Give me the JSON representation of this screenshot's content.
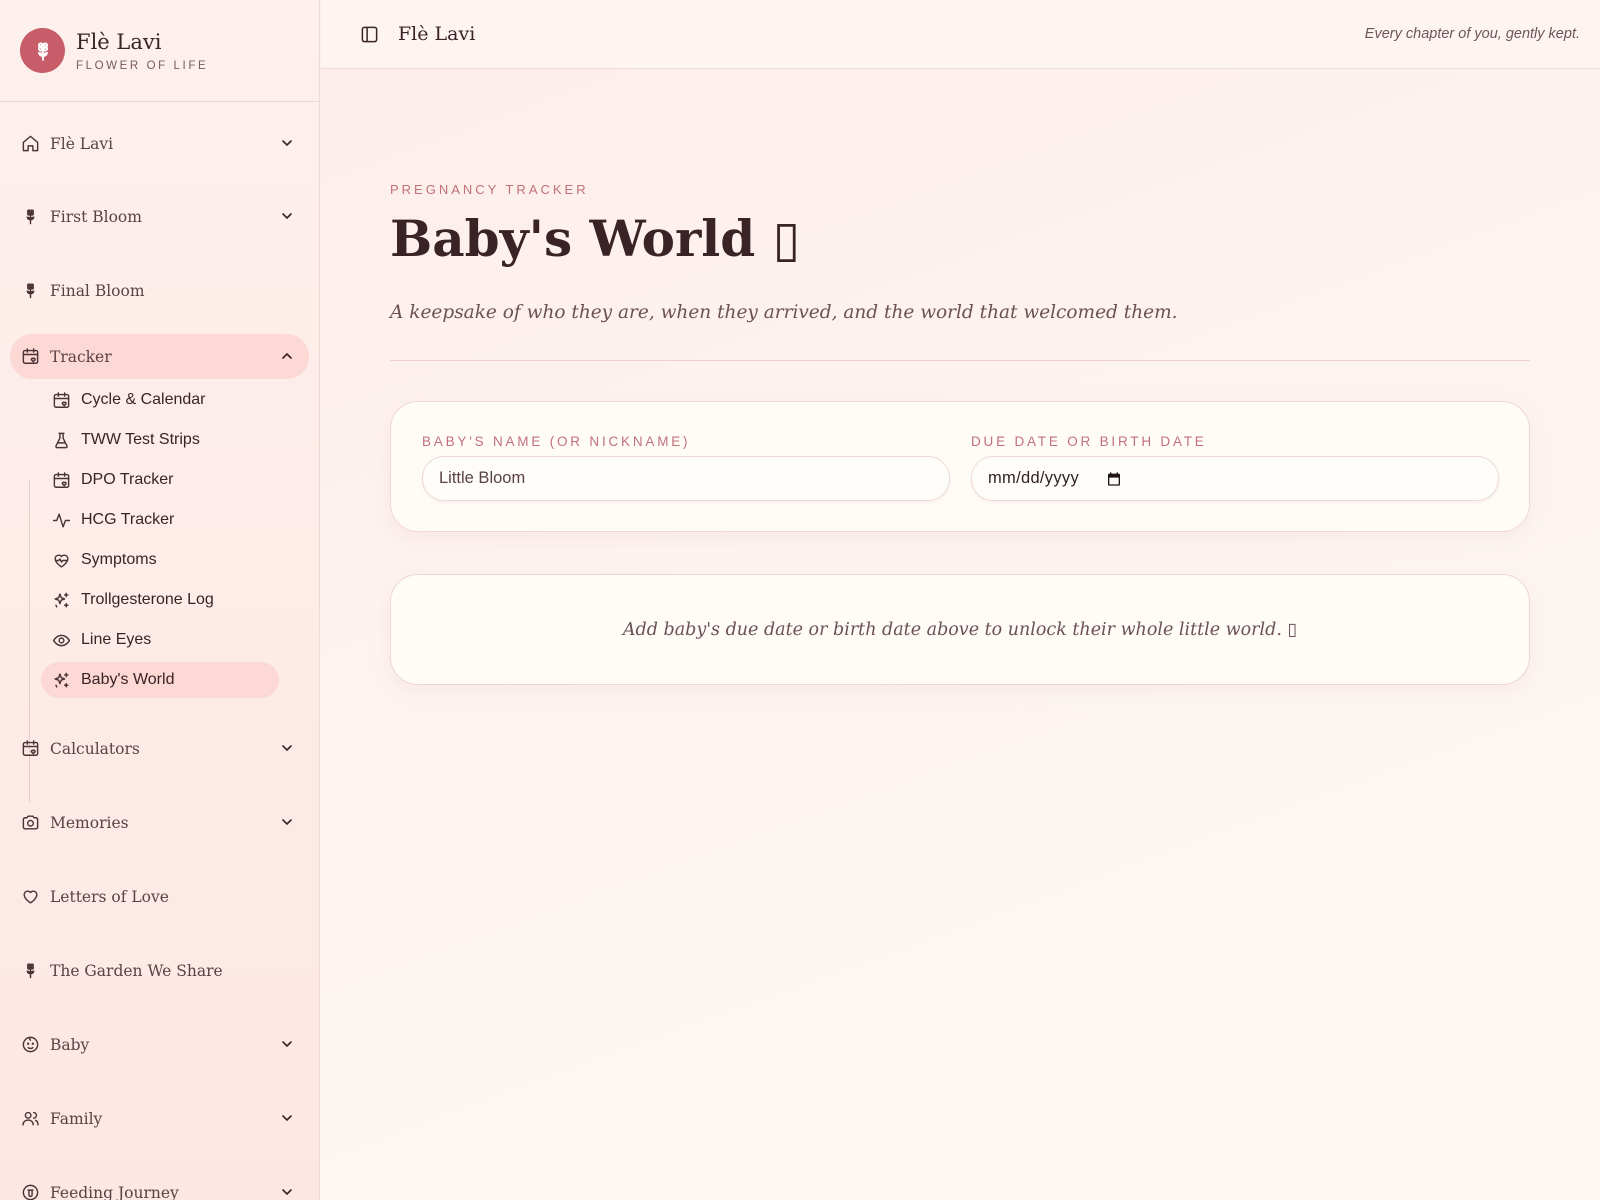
{
  "brand": {
    "title": "Flè Lavi",
    "subtitle": "FLOWER OF LIFE"
  },
  "topbar": {
    "title": "Flè Lavi",
    "tagline": "Every chapter of you, gently kept."
  },
  "sidebar": {
    "items": [
      {
        "label": "Flè Lavi",
        "icon": "home-icon",
        "chevron": "down"
      },
      {
        "label": "First Bloom",
        "icon": "flower-icon",
        "chevron": "down"
      },
      {
        "label": "Final Bloom",
        "icon": "flower-icon"
      },
      {
        "label": "Tracker",
        "icon": "calendar-heart-icon",
        "chevron": "up",
        "active": true
      },
      {
        "label": "Calculators",
        "icon": "calendar-heart-icon",
        "chevron": "down"
      },
      {
        "label": "Memories",
        "icon": "camera-icon",
        "chevron": "down"
      },
      {
        "label": "Letters of Love",
        "icon": "heart-icon"
      },
      {
        "label": "The Garden We Share",
        "icon": "flower-icon"
      },
      {
        "label": "Baby",
        "icon": "baby-icon",
        "chevron": "down"
      },
      {
        "label": "Family",
        "icon": "users-icon",
        "chevron": "down"
      },
      {
        "label": "Feeding Journey",
        "icon": "milk-icon",
        "chevron": "down"
      }
    ],
    "tracker_sub": [
      {
        "label": "Cycle & Calendar",
        "icon": "calendar-heart-icon"
      },
      {
        "label": "TWW Test Strips",
        "icon": "flask-icon"
      },
      {
        "label": "DPO Tracker",
        "icon": "calendar-heart-icon"
      },
      {
        "label": "HCG Tracker",
        "icon": "activity-icon"
      },
      {
        "label": "Symptoms",
        "icon": "heart-pulse-icon"
      },
      {
        "label": "Trollgesterone Log",
        "icon": "sparkles-icon"
      },
      {
        "label": "Line Eyes",
        "icon": "eye-icon"
      },
      {
        "label": "Baby's World",
        "icon": "sparkles-icon",
        "active": true
      }
    ]
  },
  "main": {
    "eyebrow": "PREGNANCY TRACKER",
    "title": "Baby's World ▯",
    "subtitle": "A keepsake of who they are, when they arrived, and the world that welcomed them.",
    "form": {
      "name_label": "BABY'S NAME (OR NICKNAME)",
      "name_value": "Little Bloom",
      "date_label": "DUE DATE OR BIRTH DATE",
      "date_value": "mm/dd/yyyy"
    },
    "empty_message": "Add baby's due date or birth date above to unlock their whole little world. ▯"
  },
  "colors": {
    "accent": "#c75d69",
    "active_bg": "#fdd9d5",
    "label_pink": "#c2707a"
  }
}
